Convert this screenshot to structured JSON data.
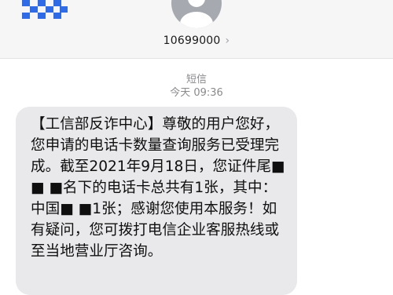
{
  "colors": {
    "header_bg": "#f6f6f6",
    "bubble_bg": "#e9e9eb",
    "logo_blue": "#2f6be4",
    "meta_gray": "#8a8a8e"
  },
  "header": {
    "contact_number": "10699000",
    "chevron_icon": "chevron-right-icon",
    "avatar_icon": "person-avatar-icon",
    "logo_icon": "mosaic-logo-icon"
  },
  "conversation": {
    "channel_label": "短信",
    "timestamp": "今天 09:36"
  },
  "message": {
    "text": "【工信部反诈中心】尊敬的用户您好，您申请的电话卡数量查询服务已受理完成。截至2021年9月18日，您证件尾■ ■ ■名下的电话卡总共有1张，其中：中国■ ■1张；感谢您使用本服务！如有疑问，您可拨打电信企业客服热线或至当地营业厅咨询。"
  }
}
